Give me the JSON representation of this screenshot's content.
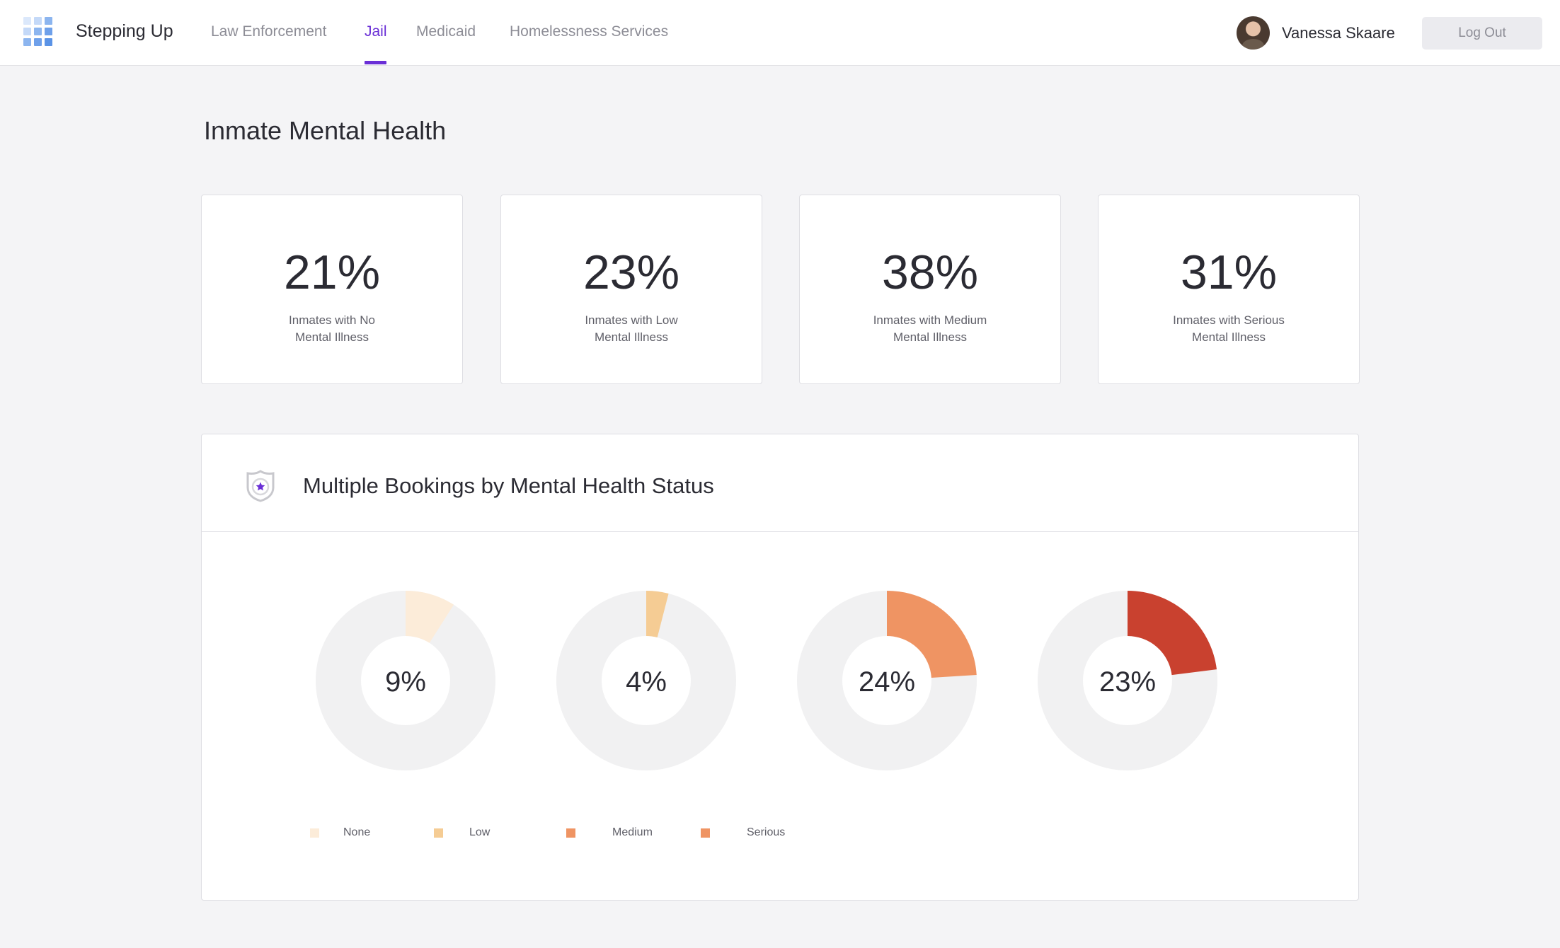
{
  "app": {
    "name": "Stepping Up"
  },
  "nav": {
    "items": [
      {
        "label": "Law Enforcement",
        "active": false
      },
      {
        "label": "Jail",
        "active": true
      },
      {
        "label": "Medicaid",
        "active": false
      },
      {
        "label": "Homelessness Services",
        "active": false
      }
    ]
  },
  "user": {
    "name": "Vanessa Skaare",
    "logout_label": "Log Out"
  },
  "page": {
    "title": "Inmate Mental Health"
  },
  "stats": [
    {
      "value": "21%",
      "label_line1": "Inmates with No",
      "label_line2": "Mental Illness"
    },
    {
      "value": "23%",
      "label_line1": "Inmates with Low",
      "label_line2": "Mental Illness"
    },
    {
      "value": "38%",
      "label_line1": "Inmates with Medium",
      "label_line2": "Mental Illness"
    },
    {
      "value": "31%",
      "label_line1": "Inmates with Serious",
      "label_line2": "Mental Illness"
    }
  ],
  "colors": {
    "accent": "#6a2fd6",
    "track": "#f1f1f2",
    "none": "#fcecd9",
    "low": "#f5cc94",
    "medium": "#ef9463",
    "serious": "#c9412f"
  },
  "panel": {
    "title": "Multiple Bookings by Mental Health Status",
    "icon": "badge-star-icon"
  },
  "chart_data": {
    "type": "pie",
    "title": "Multiple Bookings by Mental Health Status",
    "series": [
      {
        "name": "None",
        "value": 9,
        "label": "9%",
        "color": "#fcecd9"
      },
      {
        "name": "Low",
        "value": 4,
        "label": "4%",
        "color": "#f5cc94"
      },
      {
        "name": "Medium",
        "value": 24,
        "label": "24%",
        "color": "#ef9463"
      },
      {
        "name": "Serious",
        "value": 23,
        "label": "23%",
        "color": "#c9412f"
      }
    ],
    "legend": [
      {
        "label": "None",
        "color": "#fcecd9"
      },
      {
        "label": "Low",
        "color": "#f5cc94"
      },
      {
        "label": "Medium",
        "color": "#ef9463"
      },
      {
        "label": "Serious",
        "color": "#ef9463"
      }
    ],
    "legend_position": "bottom-left"
  }
}
